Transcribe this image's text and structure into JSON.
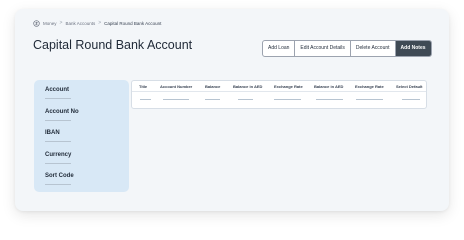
{
  "breadcrumb": {
    "icon": "money-icon",
    "items": [
      "Money",
      "Bank Accounts",
      "Capital Round Bank Account"
    ],
    "separator": ">"
  },
  "page": {
    "title": "Capital Round Bank Account"
  },
  "actions": {
    "add_loan": "Add Loan",
    "edit_account": "Edit Account Details",
    "delete_account": "Delete Account",
    "add_notes": "Add Notes"
  },
  "side_panel": {
    "fields": [
      "Account",
      "Account No",
      "IBAN",
      "Currency",
      "Sort Code"
    ]
  },
  "table": {
    "columns": [
      "Title",
      "Account Number",
      "Balance",
      "Balance in AED",
      "Exchange Rate",
      "Balance in AED",
      "Exchange Rate",
      "Select Default"
    ]
  },
  "colors": {
    "panel": "#d8e8f6",
    "primary_button": "#3f4a55",
    "background": "#f3f6f9"
  }
}
